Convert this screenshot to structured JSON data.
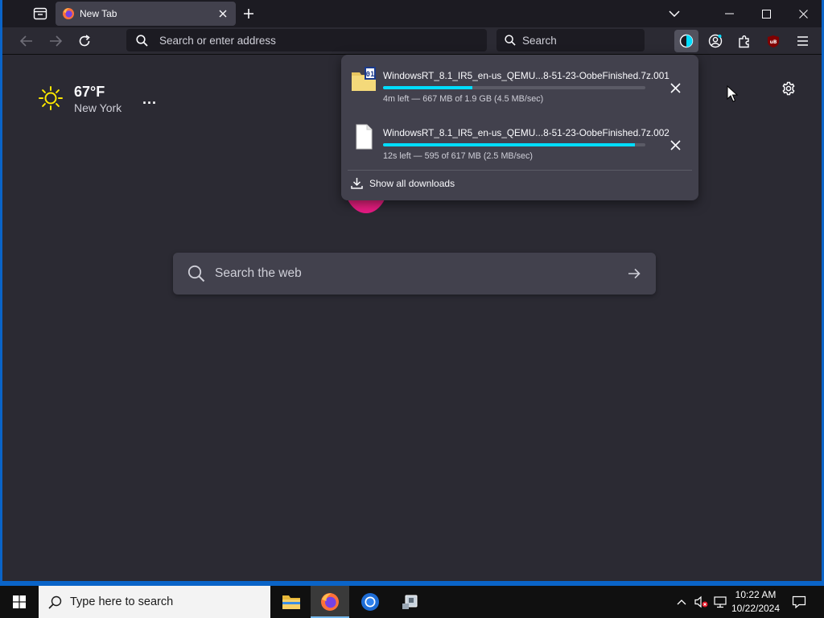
{
  "browser": {
    "tab": {
      "title": "New Tab"
    },
    "urlbar": {
      "placeholder": "Search or enter address"
    },
    "searchbar": {
      "placeholder": "Search"
    }
  },
  "newtab": {
    "weather": {
      "temperature": "67°F",
      "city": "New York",
      "more": "..."
    },
    "search": {
      "placeholder": "Search the web"
    }
  },
  "downloads_panel": {
    "items": [
      {
        "filename": "WindowsRT_8.1_IR5_en-us_QEMU...8-51-23-OobeFinished.7z.001",
        "status": "4m left — 667 MB of 1.9 GB (4.5 MB/sec)",
        "progress": 0.34,
        "icon": "archive-file-icon"
      },
      {
        "filename": "WindowsRT_8.1_IR5_en-us_QEMU...8-51-23-OobeFinished.7z.002",
        "status": "12s left — 595 of 617 MB (2.5 MB/sec)",
        "progress": 0.96,
        "icon": "blank-file-icon"
      }
    ],
    "show_all": "Show all downloads"
  },
  "taskbar": {
    "search_placeholder": "Type here to search",
    "time": "10:22 AM",
    "date": "10/22/2024"
  },
  "colors": {
    "accent": "#00ddff",
    "window_border": "#0a64c8",
    "page_bg": "#2b2a33",
    "panel_bg": "#42414d"
  }
}
